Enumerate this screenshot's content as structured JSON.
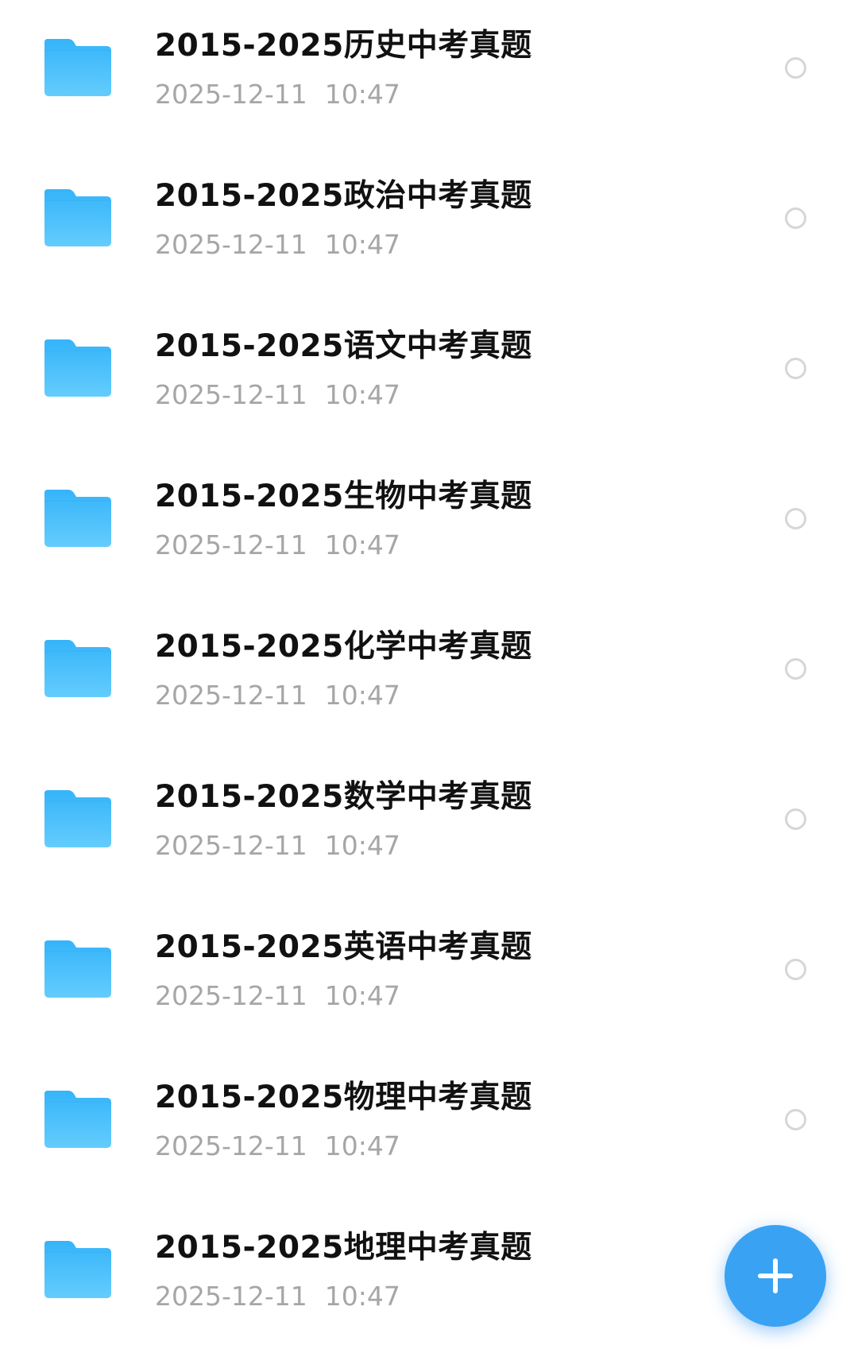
{
  "colors": {
    "folder": "#4cc1fb",
    "title": "#111111",
    "meta": "#a6a6a6",
    "fab": "#3aa2f3"
  },
  "files": [
    {
      "name": "2015-2025历史中考真题",
      "date": "2025-12-11",
      "time": "10:47"
    },
    {
      "name": "2015-2025政治中考真题",
      "date": "2025-12-11",
      "time": "10:47"
    },
    {
      "name": "2015-2025语文中考真题",
      "date": "2025-12-11",
      "time": "10:47"
    },
    {
      "name": "2015-2025生物中考真题",
      "date": "2025-12-11",
      "time": "10:47"
    },
    {
      "name": "2015-2025化学中考真题",
      "date": "2025-12-11",
      "time": "10:47"
    },
    {
      "name": "2015-2025数学中考真题",
      "date": "2025-12-11",
      "time": "10:47"
    },
    {
      "name": "2015-2025英语中考真题",
      "date": "2025-12-11",
      "time": "10:47"
    },
    {
      "name": "2015-2025物理中考真题",
      "date": "2025-12-11",
      "time": "10:47"
    },
    {
      "name": "2015-2025地理中考真题",
      "date": "2025-12-11",
      "time": "10:47"
    }
  ],
  "fab": {
    "icon": "plus-icon"
  }
}
